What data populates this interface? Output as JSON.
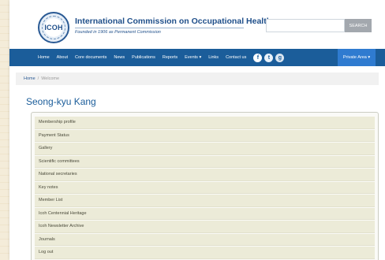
{
  "header": {
    "logo_text": "ICOH",
    "title": "International Commission on Occupational Health",
    "subtitle": "Founded in 1906 as Permanent Commission",
    "search": {
      "value": "",
      "placeholder": "",
      "button_label": "SEARCH"
    }
  },
  "nav": {
    "items": [
      {
        "label": "Home"
      },
      {
        "label": "About"
      },
      {
        "label": "Core documents"
      },
      {
        "label": "News"
      },
      {
        "label": "Publications"
      },
      {
        "label": "Reports"
      },
      {
        "label": "Events ▾"
      },
      {
        "label": "Links"
      },
      {
        "label": "Contact us"
      }
    ],
    "social": [
      {
        "icon": "facebook-icon",
        "glyph": "f"
      },
      {
        "icon": "twitter-icon",
        "glyph": "t"
      },
      {
        "icon": "google-plus-icon",
        "glyph": "g"
      }
    ],
    "private_area_label": "Private Area ▾"
  },
  "breadcrumb": {
    "home": "Home",
    "separator": "/",
    "current": "Welcome"
  },
  "page_title": "Seong-kyu Kang",
  "menu": [
    {
      "label": "Membership profile"
    },
    {
      "label": "Payment Status"
    },
    {
      "label": "Gallery"
    },
    {
      "label": "Scientific committees"
    },
    {
      "label": "National secretaries"
    },
    {
      "label": "Key notes"
    },
    {
      "label": "Member List"
    },
    {
      "label": "Icoh Centennial Heritage"
    },
    {
      "label": "Icoh Newsletter Archive"
    },
    {
      "label": "Journals"
    },
    {
      "label": "Log out"
    }
  ],
  "colors": {
    "nav_bg": "#1b5d9a",
    "private_area_bg": "#2f7bd0",
    "title_color": "#1b5d9a",
    "menu_item_bg": "#ecebd8",
    "page_background": "#f3ead6"
  }
}
